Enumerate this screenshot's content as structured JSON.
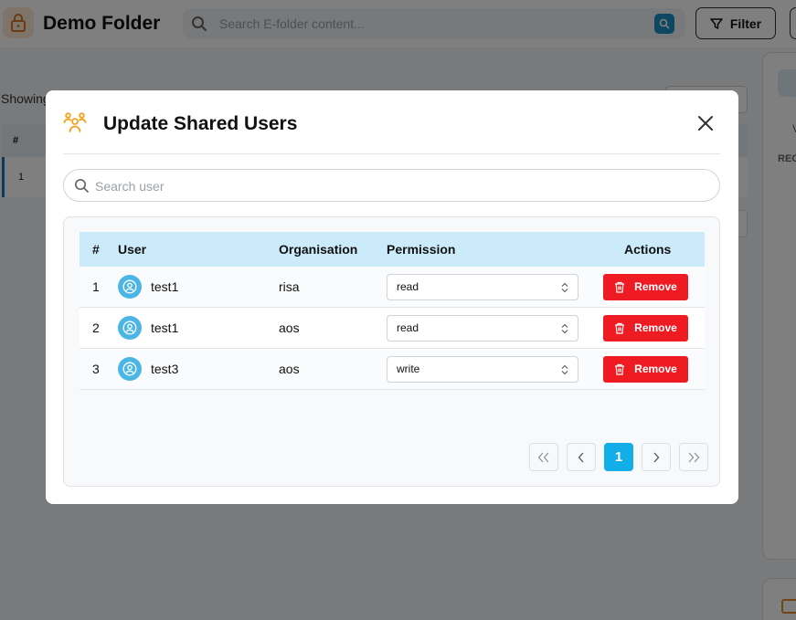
{
  "header": {
    "title": "Demo Folder",
    "search_placeholder": "Search E-folder content...",
    "filter_label": "Filter"
  },
  "background": {
    "showing_text": "Showing",
    "table_hash": "#",
    "first_row_index": "1",
    "right_panel_v": "V",
    "right_panel_rec": "REC"
  },
  "modal": {
    "title": "Update Shared Users",
    "search_placeholder": "Search user",
    "table": {
      "headers": {
        "index": "#",
        "user": "User",
        "organisation": "Organisation",
        "permission": "Permission",
        "actions": "Actions"
      },
      "rows": [
        {
          "index": "1",
          "user": "test1",
          "organisation": "risa",
          "permission": "read",
          "action": "Remove"
        },
        {
          "index": "2",
          "user": "test1",
          "organisation": "aos",
          "permission": "read",
          "action": "Remove"
        },
        {
          "index": "3",
          "user": "test3",
          "organisation": "aos",
          "permission": "write",
          "action": "Remove"
        }
      ]
    },
    "pagination": {
      "current_page": "1"
    }
  },
  "colors": {
    "accent": "#13aee8",
    "danger": "#ee1b23",
    "header_bg": "#ccebfa",
    "avatar": "#4bb6e6"
  }
}
